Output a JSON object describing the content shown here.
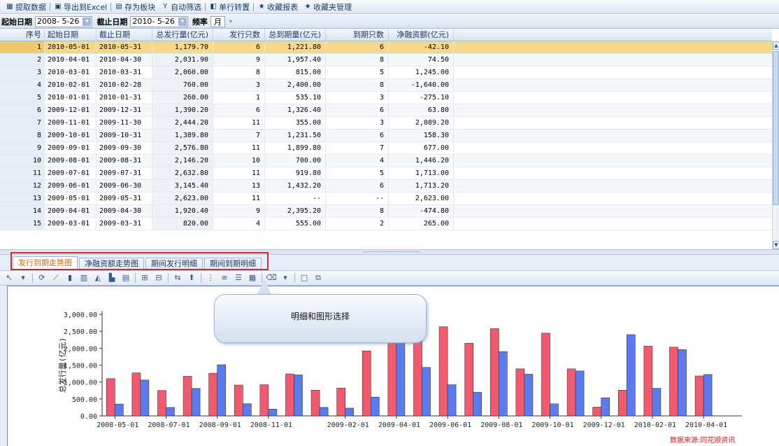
{
  "toolbar": {
    "items": [
      {
        "icon": "grid-icon",
        "glyph": "▦",
        "label": "提取数据"
      },
      {
        "icon": "excel-icon",
        "glyph": "▣",
        "label": "导出到Excel"
      },
      {
        "icon": "save-block-icon",
        "glyph": "▤",
        "label": "存为板块"
      },
      {
        "icon": "filter-icon",
        "glyph": "Y",
        "label": "自动筛选"
      },
      {
        "icon": "transpose-icon",
        "glyph": "◧",
        "label": "单行转置"
      },
      {
        "icon": "favorite-report-icon",
        "glyph": "★",
        "label": "收藏报表"
      },
      {
        "icon": "favorites-manage-icon",
        "glyph": "★",
        "label": "收藏夹管理"
      }
    ]
  },
  "filter": {
    "start_label": "起始日期",
    "start_value": "2008- 5-26",
    "end_label": "截止日期",
    "end_value": "2010- 5-26",
    "freq_label": "频率",
    "freq_value": "月"
  },
  "table": {
    "headers": [
      "序号",
      "起始日期",
      "截止日期",
      "总发行量(亿元)",
      "发行只数",
      "总到期量(亿元)",
      "到期只数",
      "净融资额(亿元)"
    ],
    "rows": [
      [
        "1",
        "2010-05-01",
        "2010-05-31",
        "1,179.70",
        "6",
        "1,221.80",
        "6",
        "-42.10"
      ],
      [
        "2",
        "2010-04-01",
        "2010-04-30",
        "2,031.90",
        "9",
        "1,957.40",
        "8",
        "74.50"
      ],
      [
        "3",
        "2010-03-01",
        "2010-03-31",
        "2,060.00",
        "8",
        "815.00",
        "5",
        "1,245.00"
      ],
      [
        "4",
        "2010-02-01",
        "2010-02-28",
        "760.00",
        "3",
        "2,400.00",
        "8",
        "-1,640.00"
      ],
      [
        "5",
        "2010-01-01",
        "2010-01-31",
        "260.00",
        "1",
        "535.10",
        "3",
        "-275.10"
      ],
      [
        "6",
        "2009-12-01",
        "2009-12-31",
        "1,390.20",
        "6",
        "1,326.40",
        "6",
        "63.80"
      ],
      [
        "7",
        "2009-11-01",
        "2009-11-30",
        "2,444.20",
        "11",
        "355.00",
        "3",
        "2,089.20"
      ],
      [
        "8",
        "2009-10-01",
        "2009-10-31",
        "1,389.80",
        "7",
        "1,231.50",
        "6",
        "158.30"
      ],
      [
        "9",
        "2009-09-01",
        "2009-09-30",
        "2,576.80",
        "11",
        "1,899.80",
        "7",
        "677.00"
      ],
      [
        "10",
        "2009-08-01",
        "2009-08-31",
        "2,146.20",
        "10",
        "700.00",
        "4",
        "1,446.20"
      ],
      [
        "11",
        "2009-07-01",
        "2009-07-31",
        "2,632.80",
        "11",
        "919.80",
        "5",
        "1,713.00"
      ],
      [
        "12",
        "2009-06-01",
        "2009-06-30",
        "3,145.40",
        "13",
        "1,432.20",
        "6",
        "1,713.20"
      ],
      [
        "13",
        "2009-05-01",
        "2009-05-31",
        "2,623.00",
        "11",
        "--",
        "--",
        "2,623.00"
      ],
      [
        "14",
        "2009-04-01",
        "2009-04-30",
        "1,920.40",
        "9",
        "2,395.20",
        "8",
        "-474.80"
      ],
      [
        "15",
        "2009-03-01",
        "2009-03-31",
        "820.00",
        "4",
        "555.00",
        "2",
        "265.00"
      ]
    ]
  },
  "tabs": [
    "发行到期走势图",
    "净融资额走势图",
    "期间发行明细",
    "期间到期明细"
  ],
  "chart_tools": [
    {
      "icon": "pointer-icon",
      "glyph": "↖"
    },
    {
      "icon": "dropdown-arrow-icon",
      "glyph": "▾"
    },
    {
      "icon": "refresh-icon",
      "glyph": "⟳"
    },
    {
      "icon": "line-chart-icon",
      "glyph": "⟋"
    },
    {
      "icon": "bar-chart-icon",
      "glyph": "▮"
    },
    {
      "icon": "column-chart-icon",
      "glyph": "▥"
    },
    {
      "icon": "area-chart-icon",
      "glyph": "◭"
    },
    {
      "icon": "stacked-chart-icon",
      "glyph": "▙"
    },
    {
      "icon": "horizontal-bar-icon",
      "glyph": "▤"
    },
    {
      "icon": "add-row-icon",
      "glyph": "⊞"
    },
    {
      "icon": "remove-row-icon",
      "glyph": "⊟"
    },
    {
      "icon": "swap-icon",
      "glyph": "⇆"
    },
    {
      "icon": "select-icon",
      "glyph": "⬆"
    },
    {
      "icon": "grid-lines-icon",
      "glyph": "⋮"
    },
    {
      "icon": "list-icon",
      "glyph": "≡"
    },
    {
      "icon": "list-detail-icon",
      "glyph": "☰"
    },
    {
      "icon": "table-icon",
      "glyph": "▦"
    },
    {
      "icon": "eraser-icon",
      "glyph": "⌫"
    },
    {
      "icon": "dropdown-arrow-icon",
      "glyph": "▾"
    },
    {
      "icon": "frame-icon",
      "glyph": "□"
    },
    {
      "icon": "windows-icon",
      "glyph": "⧉"
    }
  ],
  "callout": {
    "text": "明细和图形选择"
  },
  "source_text": "数据来源:同花顺资讯",
  "colors": {
    "issue": "#f45a6e",
    "mature": "#5a7cf0",
    "selected_row": "#f6d88a",
    "tab_active": "#e06a0d",
    "highlight_box": "#d2282e"
  },
  "chart_data": {
    "type": "bar",
    "ylabel": "总发行量(亿元)",
    "ylim": [
      0,
      3000
    ],
    "yticks": [
      "0.00",
      "500.00",
      "1,000.00",
      "1,500.00",
      "2,000.00",
      "2,500.00",
      "3,000.00"
    ],
    "x_tick_labels": [
      "2008-05-01",
      "2008-07-01",
      "2008-09-01",
      "2008-11-01",
      "2009-02-01",
      "2009-04-01",
      "2009-06-01",
      "2009-08-01",
      "2009-10-01",
      "2009-12-01",
      "2010-02-01",
      "2010-04-01"
    ],
    "categories": [
      "2008-05",
      "2008-06",
      "2008-07",
      "2008-08",
      "2008-09",
      "2008-10",
      "2008-11",
      "2008-12",
      "2009-01",
      "2009-02",
      "2009-03",
      "2009-04",
      "2009-05",
      "2009-06",
      "2009-07",
      "2009-08",
      "2009-09",
      "2009-10",
      "2009-11",
      "2009-12",
      "2010-01",
      "2010-02",
      "2010-03",
      "2010-04",
      "2010-05"
    ],
    "series": [
      {
        "values": [
          1100,
          1270,
          750,
          1170,
          1260,
          910,
          920,
          1240,
          760,
          820,
          1920,
          2623,
          3145.4,
          2632.8,
          2146.2,
          2576.8,
          1389.8,
          2444.2,
          1390.2,
          260,
          760,
          2060,
          2031.9,
          1179.7,
          0
        ]
      },
      {
        "values": [
          350,
          1060,
          250,
          810,
          1510,
          360,
          200,
          1210,
          250,
          230,
          555,
          2395.2,
          1432.2,
          919.8,
          700,
          1899.8,
          1231.5,
          355,
          1326.4,
          535.1,
          2400,
          815,
          1957.4,
          1221.8,
          0
        ]
      }
    ]
  }
}
